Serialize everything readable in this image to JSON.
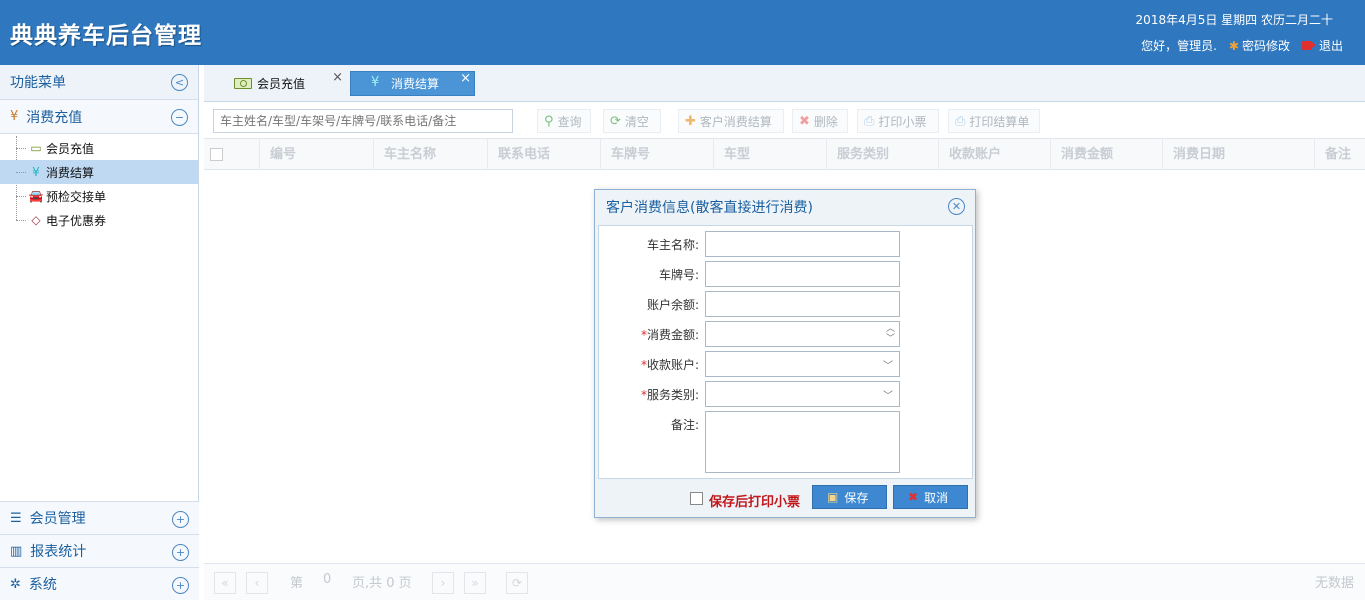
{
  "header": {
    "brand": "典典养车后台管理",
    "date": "2018年4月5日 星期四 农历二月二十",
    "greeting": "您好，管理员.",
    "change_password": "密码修改",
    "logout": "退出"
  },
  "sidebar": {
    "title": "功能菜单",
    "section": "消费充值",
    "items": [
      {
        "label": "会员充值",
        "icon": "money-icon"
      },
      {
        "label": "消费结算",
        "icon": "yen-icon"
      },
      {
        "label": "预检交接单",
        "icon": "car-icon"
      },
      {
        "label": "电子优惠券",
        "icon": "coupon-icon"
      }
    ],
    "bottom_sections": [
      "会员管理",
      "报表统计",
      "系统"
    ]
  },
  "tabs": [
    {
      "label": "会员充值"
    },
    {
      "label": "消费结算"
    }
  ],
  "toolbar": {
    "search_placeholder": "车主姓名/车型/车架号/车牌号/联系电话/备注",
    "query": "查询",
    "clear": "清空",
    "customer_settle": "客户消费结算",
    "delete": "删除",
    "print_ticket": "打印小票",
    "print_bill": "打印结算单"
  },
  "grid": {
    "columns": [
      "编号",
      "车主名称",
      "联系电话",
      "车牌号",
      "车型",
      "服务类别",
      "收款账户",
      "消费金额",
      "消费日期",
      "备注"
    ]
  },
  "pager": {
    "page_prefix": "第",
    "page_value": "0",
    "page_suffix": "页,共 0 页",
    "status": "无数据"
  },
  "dialog": {
    "title": "客户消费信息(散客直接进行消费)",
    "fields": [
      {
        "label": "车主名称:",
        "required": false
      },
      {
        "label": "车牌号:",
        "required": false
      },
      {
        "label": "账户余额:",
        "required": false
      },
      {
        "label": "消费金额:",
        "required": true
      },
      {
        "label": "收款账户:",
        "required": true
      },
      {
        "label": "服务类别:",
        "required": true
      },
      {
        "label": "备注:",
        "required": false
      }
    ],
    "print_after_save": "保存后打印小票",
    "save": "保存",
    "cancel": "取消"
  },
  "colors": {
    "header_bg": "#2f78bf",
    "active_tab": "#4b95d6",
    "required": "#e02f2f"
  }
}
